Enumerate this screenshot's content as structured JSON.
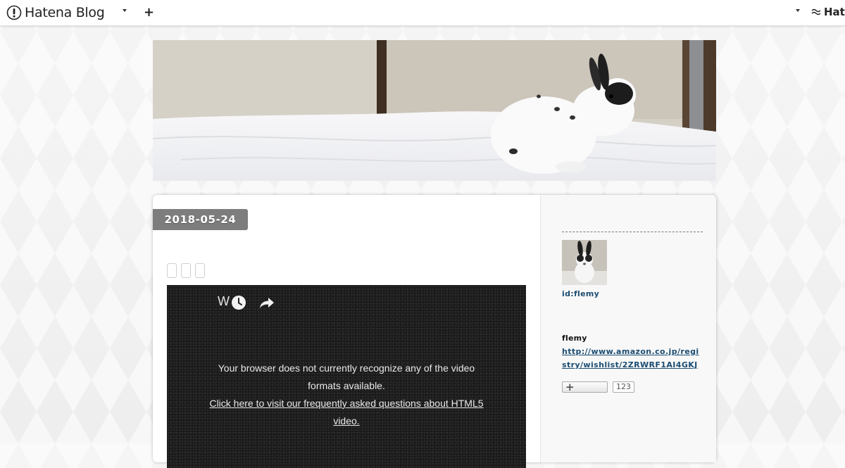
{
  "header": {
    "brand": "Hatena Blog",
    "right_brand": "Hate",
    "add_icon": "plus-icon",
    "colors": {
      "background": "#ffffff",
      "text": "#222222"
    }
  },
  "blog": {
    "header_image": "rabbit-on-bed-banner"
  },
  "entry": {
    "date": "2018-05-24",
    "date_badge_color": "#7d7d7d",
    "video": {
      "title": "W",
      "message_line": "Your browser does not currently recognize any of the video formats available.",
      "link_text": "Click here to visit our frequently asked questions about HTML5 video.",
      "icons": [
        "clock-icon",
        "share-icon"
      ]
    }
  },
  "sidebar": {
    "user_id": "id:flemy",
    "name": "flemy",
    "link": "http://www.amazon.co.jp/registry/wishlist/2ZRWRF1AI4GKJ",
    "subscriber_count": "123",
    "subscribe_icon": "plus-icon",
    "link_color": "#1a4c72"
  }
}
